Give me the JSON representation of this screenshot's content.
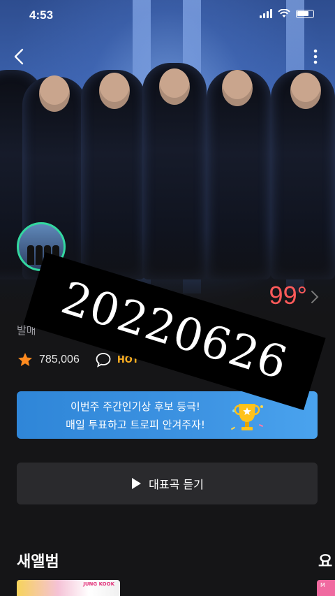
{
  "status_bar": {
    "time": "4:53"
  },
  "artist": {
    "name": "",
    "subtitle": "발매",
    "temperature": "99°",
    "fan_count": "785,006",
    "hot_label": "HOT"
  },
  "vote_banner": {
    "line1": "이번주 주간인기상 후보 등극!",
    "line2": "매일 투표하고 트로피 안겨주자!"
  },
  "listen_button": {
    "label": "대표곡 듣기"
  },
  "sections": {
    "new_album_title": "새앨범",
    "next_title": "요"
  },
  "album": {
    "thumb_label": "JUNG KOOK",
    "thumb2_label": "M"
  },
  "overlay": {
    "date": "20220626"
  },
  "colors": {
    "background": "#151517",
    "temperature": "#ff5a5a",
    "banner": "#3d93e2",
    "star": "#ff8a1f",
    "avatar_ring": "#33d7a0"
  }
}
